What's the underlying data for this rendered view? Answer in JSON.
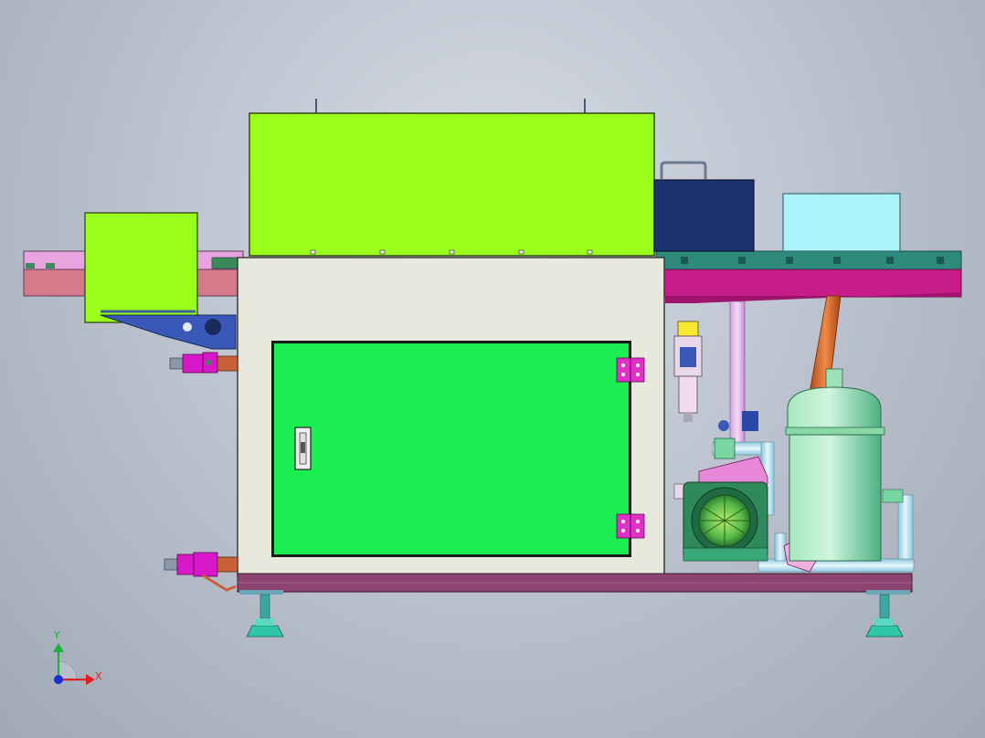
{
  "axes": {
    "x_label": "X",
    "y_label": "Y",
    "x_color": "#e02020",
    "y_color": "#19b33c",
    "origin_color": "#1a2cd6"
  },
  "colors": {
    "background_center": "#d8dde6",
    "background_edge": "#a2a9b6",
    "top_enclosure": "#9aff1a",
    "left_enclosure": "#9aff1a",
    "cabinet": "#e8e8dc",
    "cabinet_door": "#1aee50",
    "hinge": "#e030c8",
    "control_box": "#1a336e",
    "cyan_box": "#a8f4f8",
    "conveyor_left": "#e8a4e0",
    "conveyor_right": "#c81c88",
    "base_frame": "#8c4470",
    "tank": "#78d6a0",
    "motor": "#2e8a5a",
    "copper_pipe": "#d06028",
    "pipe_light_blue": "#b8e4f4",
    "valve_magenta": "#d818c8",
    "filter_yellow": "#f8e830"
  },
  "icons": {
    "axis_triad": "xyz-axis-triad-icon",
    "door_latch": "door-latch-icon",
    "hinge": "door-hinge-icon",
    "leveling_foot": "leveling-foot-icon"
  }
}
